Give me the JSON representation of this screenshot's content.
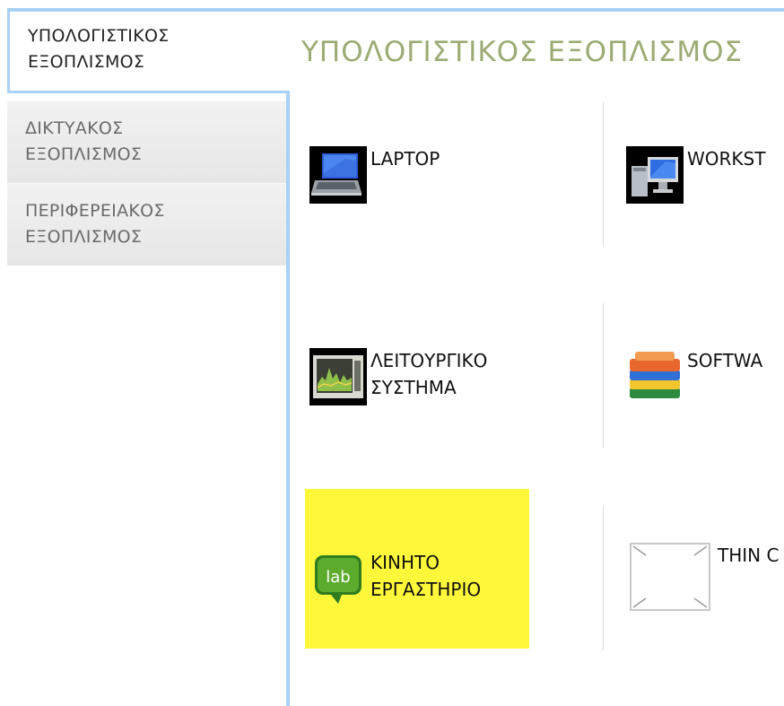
{
  "sidebar": {
    "tabs": [
      {
        "line1": "ΥΠΟΛΟΓΙΣΤΙΚΟΣ",
        "line2": "ΕΞΟΠΛΙΣΜΟΣ",
        "active": true
      },
      {
        "line1": "ΔΙΚΤΥΑΚΟΣ",
        "line2": "ΕΞΟΠΛΙΣΜΟΣ",
        "active": false
      },
      {
        "line1": "ΠΕΡΙΦΕΡΕΙΑΚΟΣ",
        "line2": "ΕΞΟΠΛΙΣΜΟΣ",
        "active": false
      }
    ]
  },
  "main": {
    "title": "ΥΠΟΛΟΓΙΣΤΙΚΟΣ ΕΞΟΠΛΙΣΜΟΣ",
    "items": [
      {
        "line1": "LAPTOP",
        "line2": "",
        "icon": "laptop-icon"
      },
      {
        "line1": "WORKST",
        "line2": "",
        "icon": "workstation-icon"
      },
      {
        "line1": "ΛΕΙΤΟΥΡΓΙΚΟ",
        "line2": "ΣΥΣΤΗΜΑ",
        "icon": "operating-system-icon"
      },
      {
        "line1": "SOFTWA",
        "line2": "",
        "icon": "software-stack-icon"
      },
      {
        "line1": "ΚΙΝΗΤΟ",
        "line2": "ΕΡΓΑΣΤΗΡΙΟ",
        "icon": "lab-icon",
        "icon_text": "lab",
        "highlight_color": "#fff83a"
      },
      {
        "line1": "THIN C",
        "line2": "",
        "icon": "missing-image-icon"
      }
    ]
  },
  "colors": {
    "accent_border": "#a9d1f5",
    "heading": "#9cab73",
    "highlight": "#fff83a"
  }
}
